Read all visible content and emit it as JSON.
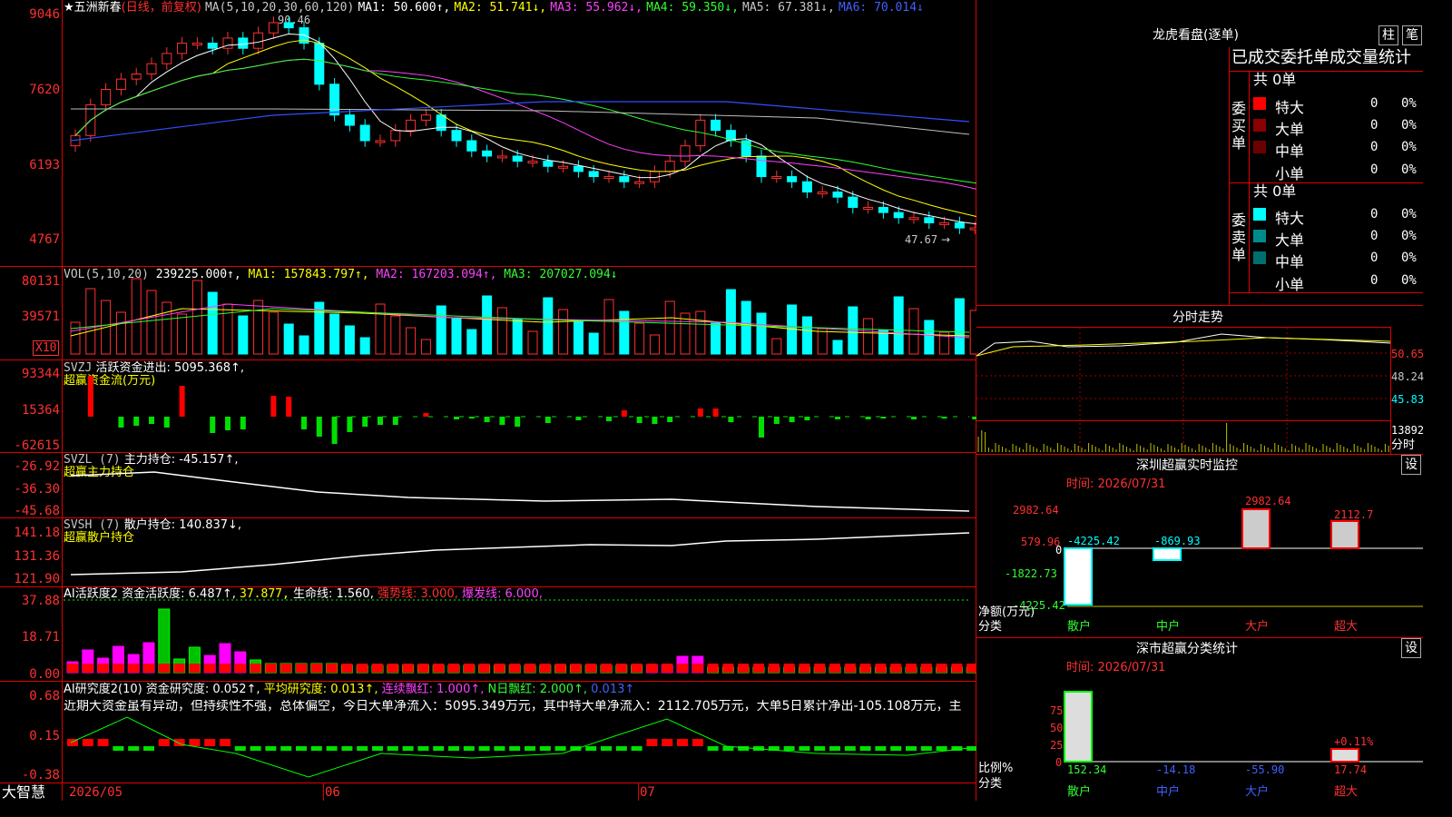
{
  "window": {
    "brand": "大智慧"
  },
  "kline": {
    "stock_name": "五洲新春",
    "period": "(日线，前复权)",
    "ma_params": "MA(5,10,20,30,60,120)",
    "ma1": "MA1: 50.600↑,",
    "ma2": "MA2: 51.741↓,",
    "ma3": "MA3: 55.962↓,",
    "ma4": "MA4: 59.350↓,",
    "ma5": "MA5: 67.381↓,",
    "ma6": "MA6: 70.014↓",
    "high_label": "90.46",
    "low_label": "47.67",
    "y_labels": [
      "9046",
      "7620",
      "6193",
      "4767"
    ]
  },
  "vol": {
    "header": "VOL(5,10,20)",
    "value": "239225.000↑,",
    "ma1": "MA1: 157843.797↑,",
    "ma2": "MA2: 167203.094↑,",
    "ma3": "MA3: 207027.094↓",
    "y_labels": [
      "80131",
      "39571"
    ],
    "unit": "X10"
  },
  "svzj": {
    "header": "SVZJ",
    "title": "活跃资金进出: 5095.368↑,",
    "sub": "超赢资金流(万元)",
    "y_labels": [
      "93344",
      "15364",
      "-62615"
    ],
    "bars": [
      0,
      45,
      0,
      -12,
      -10,
      -8,
      -12,
      34,
      0,
      -18,
      -15,
      -14,
      0,
      23,
      22,
      -14,
      -22,
      -30,
      -17,
      -11,
      -9,
      -9,
      0,
      4,
      0,
      -3,
      -2,
      -6,
      -9,
      -11,
      0,
      -7,
      0,
      -4,
      0,
      -5,
      7,
      -7,
      -8,
      -6,
      0,
      9,
      9,
      -6,
      0,
      -23,
      -8,
      -6,
      -4,
      0,
      -3,
      0,
      -3,
      -2,
      0,
      -3,
      0,
      -2,
      0,
      -3,
      -3,
      0,
      -3,
      0,
      0,
      0
    ]
  },
  "svzl": {
    "header": "SVZL (7)",
    "title": "主力持仓: -45.157↑,",
    "sub": "超赢主力持仓",
    "y_labels": [
      "-26.92",
      "-36.30",
      "-45.68"
    ]
  },
  "svsh": {
    "header": "SVSH (7)",
    "title": "散户持仓: 140.837↓,",
    "sub": "超赢散户持仓",
    "y_labels": [
      "141.18",
      "131.36",
      "121.90"
    ]
  },
  "ai1": {
    "header": "AI活跃度2 资金活跃度: 6.487↑,",
    "v2": "37.877,",
    "v3": "生命线: 1.560,",
    "v4": "强势线: 3.000,",
    "v5": "爆发线: 6.000,",
    "y_labels": [
      "37.88",
      "18.71",
      "0.00"
    ]
  },
  "ai2": {
    "header": "AI研究度2(10) 资金研究度: 0.052↑,",
    "v2": "平均研究度: 0.013↑,",
    "v3": "连续飘红: 1.000↑,",
    "v4": "N日飘红: 2.000↑,",
    "v5": "0.013↑",
    "comment": "近期大资金虽有异动，但持续性不强，总体偏空，今日大单净流入：5095.349万元，其中特大单净流入：2112.705万元，大单5日累计净出-105.108万元，主",
    "y_labels": [
      "0.68",
      "0.15",
      "-0.38"
    ]
  },
  "xaxis": {
    "labels": [
      "2026/05",
      "06",
      "07"
    ]
  },
  "lhb": {
    "title": "龙虎看盘(逐单)",
    "btn1": "柱",
    "btn2": "笔",
    "subtitle": "已成交委托单成交量统计",
    "buy_total": "共 0单",
    "sell_total": "共 0单",
    "buy_label": [
      "委",
      "买",
      "单"
    ],
    "sell_label": [
      "委",
      "卖",
      "单"
    ],
    "rows": [
      {
        "name": "特大",
        "v": "0",
        "p": "0%"
      },
      {
        "name": "大单",
        "v": "0",
        "p": "0%"
      },
      {
        "name": "中单",
        "v": "0",
        "p": "0%"
      },
      {
        "name": "小单",
        "v": "0",
        "p": "0%"
      }
    ],
    "buy_colors": [
      "#ff0000",
      "#8b0000",
      "#6a0000",
      "#000000"
    ],
    "sell_colors": [
      "#00ffff",
      "#008b8b",
      "#006f6f",
      "#000000"
    ]
  },
  "fenshi": {
    "title": "分时走势",
    "y_labels": [
      "50.65",
      "48.24",
      "45.83",
      "13892"
    ],
    "unit": "分时"
  },
  "monitor": {
    "title": "深圳超赢实时监控",
    "btn": "设",
    "time": "时间: 2026/07/31",
    "y_labels": [
      "2982.64",
      "579.96",
      "0",
      "-1822.73",
      "-4225.42"
    ],
    "unit1": "净额(万元)",
    "unit2": "分类",
    "cats": [
      "散户",
      "中户",
      "大户",
      "超大"
    ],
    "values": [
      "-4225.42",
      "-869.93",
      "2982.64",
      "2112.7"
    ]
  },
  "classify": {
    "title": "深市超赢分类统计",
    "btn": "设",
    "time": "时间: 2026/07/31",
    "y_labels": [
      "75",
      "50",
      "25",
      "0"
    ],
    "unit1": "比例%",
    "unit2": "分类",
    "cats": [
      "散户",
      "中户",
      "大户",
      "超大"
    ],
    "values": [
      "152.34",
      "-14.18",
      "-55.90",
      "17.74"
    ],
    "pct": "+0.11%"
  },
  "chart_data": [
    {
      "type": "candlestick",
      "title": "五洲新春",
      "ylim": [
        47.67,
        90.46
      ],
      "close": [
        68,
        74,
        77,
        79,
        80,
        82,
        84,
        86,
        86,
        85,
        87,
        85,
        88,
        90,
        89,
        86,
        78,
        72,
        70,
        67,
        67,
        69,
        71,
        72,
        69,
        67,
        65,
        64,
        64,
        63,
        63,
        62,
        62,
        61,
        60,
        60,
        59,
        59,
        61,
        63,
        66,
        71,
        69,
        67,
        64,
        60,
        60,
        59,
        57,
        57,
        56,
        54,
        54,
        53,
        52,
        52,
        51,
        51,
        50,
        50,
        49,
        48,
        48,
        50,
        51
      ],
      "highlights": {
        "high": 90.46,
        "low": 47.67
      }
    },
    {
      "type": "bar",
      "title": "活跃资金进出",
      "ylim": [
        -62615,
        93344
      ]
    }
  ]
}
